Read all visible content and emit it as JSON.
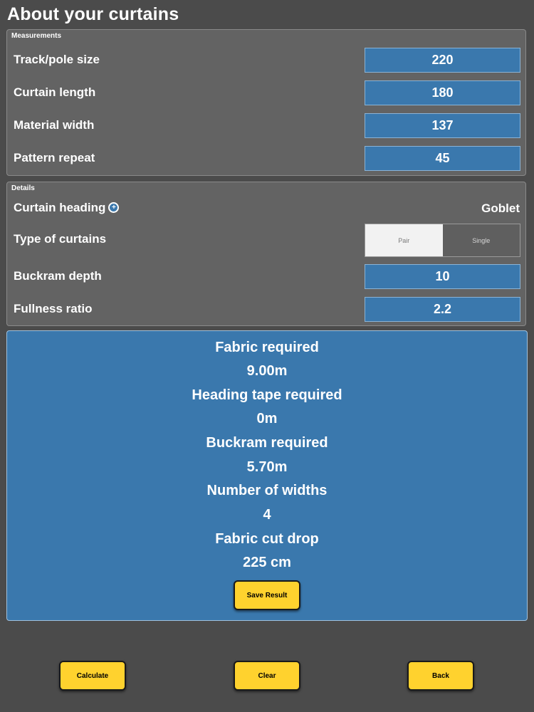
{
  "title": "About your curtains",
  "measurements": {
    "section_label": "Measurements",
    "track_pole_size": {
      "label": "Track/pole size",
      "value": "220"
    },
    "curtain_length": {
      "label": "Curtain length",
      "value": "180"
    },
    "material_width": {
      "label": "Material width",
      "value": "137"
    },
    "pattern_repeat": {
      "label": "Pattern repeat",
      "value": "45"
    }
  },
  "details": {
    "section_label": "Details",
    "curtain_heading": {
      "label": "Curtain heading",
      "value": "Goblet"
    },
    "type_of_curtains": {
      "label": "Type of curtains",
      "options": [
        "Pair",
        "Single"
      ],
      "selected": "Pair"
    },
    "buckram_depth": {
      "label": "Buckram depth",
      "value": "10"
    },
    "fullness_ratio": {
      "label": "Fullness ratio",
      "value": "2.2"
    }
  },
  "results": {
    "fabric_required": {
      "label": "Fabric required",
      "value": "9.00m"
    },
    "heading_tape_required": {
      "label": "Heading tape required",
      "value": "0m"
    },
    "buckram_required": {
      "label": "Buckram required",
      "value": "5.70m"
    },
    "number_of_widths": {
      "label": "Number of widths",
      "value": "4"
    },
    "fabric_cut_drop": {
      "label": "Fabric cut drop",
      "value": "225 cm"
    },
    "save_label": "Save Result"
  },
  "buttons": {
    "calculate": "Calculate",
    "clear": "Clear",
    "back": "Back"
  },
  "colors": {
    "background": "#4b4b4b",
    "panel": "#636363",
    "accent_blue": "#3a78ad",
    "button_yellow": "#ffd22e"
  }
}
